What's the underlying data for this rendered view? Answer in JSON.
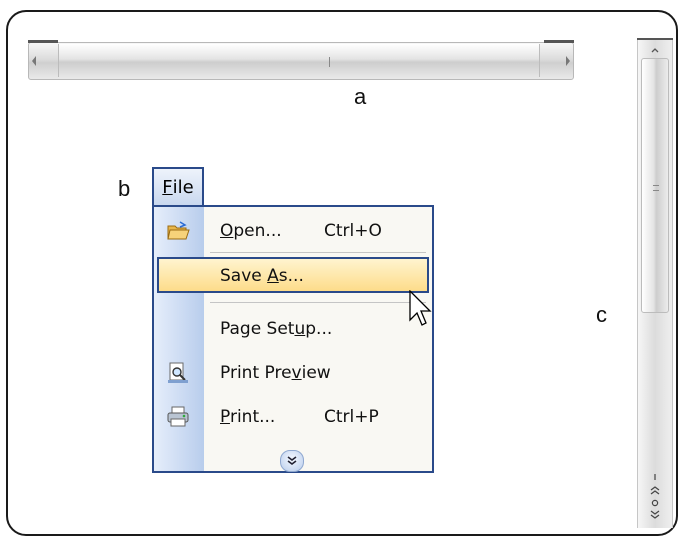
{
  "labels": {
    "a": "a",
    "b": "b",
    "c": "c"
  },
  "file_menu": {
    "tab": {
      "prefix": "",
      "accel": "F",
      "rest": "ile"
    },
    "items": [
      {
        "icon": "open-folder-icon",
        "prefix": "",
        "accel": "O",
        "rest": "pen...",
        "shortcut": "Ctrl+O"
      },
      {
        "icon": "",
        "prefix": "Save ",
        "accel": "A",
        "rest": "s...",
        "shortcut": "",
        "highlighted": true
      },
      {
        "icon": "",
        "prefix": "Page Set",
        "accel": "u",
        "rest": "p...",
        "shortcut": ""
      },
      {
        "icon": "print-preview-icon",
        "prefix": "Print Pre",
        "accel": "v",
        "rest": "iew",
        "shortcut": ""
      },
      {
        "icon": "printer-icon",
        "prefix": "",
        "accel": "P",
        "rest": "rint...",
        "shortcut": "Ctrl+P"
      }
    ],
    "expand_icon": "double-chevron-down-icon"
  },
  "colors": {
    "accent_border": "#2a4a8a",
    "highlight": "#fddc8a",
    "gutter": "#b8cdec"
  }
}
